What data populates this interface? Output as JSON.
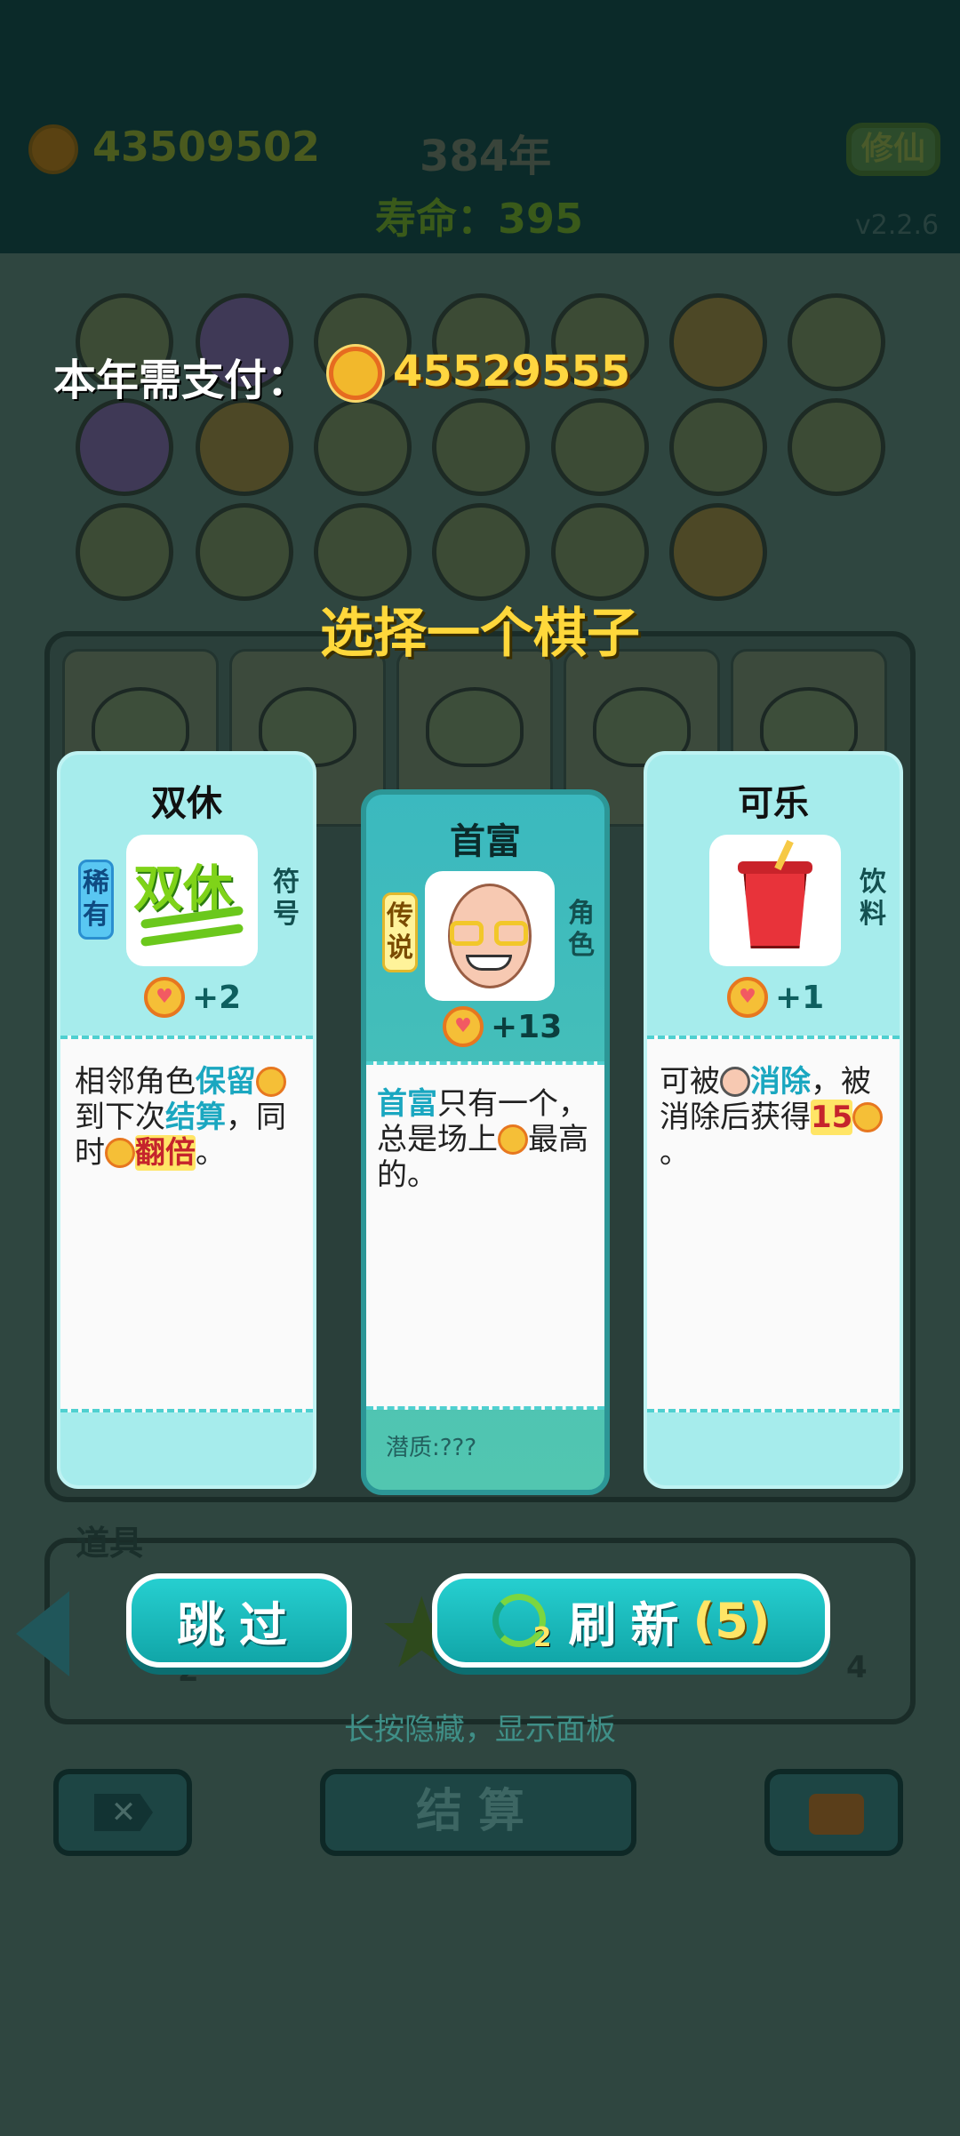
{
  "header": {
    "coins": "43509502",
    "year": "384年",
    "lifespan": "寿命：395",
    "top_button": "修仙",
    "version": "v2.2.6"
  },
  "payment": {
    "label": "本年需支付：",
    "value": "45529555"
  },
  "select_title": "选择一个棋子",
  "cards": [
    {
      "title": "双休",
      "rarity": "稀有",
      "category": "符号",
      "image_text": "双休",
      "gain": "+2",
      "desc": [
        "相邻角色",
        "保留",
        "到下次",
        "结算",
        "，同时",
        "翻倍",
        "。"
      ]
    },
    {
      "title": "首富",
      "rarity": "传说",
      "category": "角色",
      "gain": "+13",
      "desc": [
        "首富",
        "只有一个，总是场上",
        "最高的。"
      ],
      "potential": "潜质:???"
    },
    {
      "title": "可乐",
      "category": "饮料",
      "gain": "+1",
      "desc": [
        "可被",
        "消除",
        "，被消除后获得",
        "15",
        "。"
      ]
    }
  ],
  "tools": {
    "label": "道具",
    "count_left": "2",
    "count_right": "4"
  },
  "buttons": {
    "skip": "跳过",
    "refresh": "刷新",
    "refresh_count": "(5)",
    "refresh_icon_badge": "2"
  },
  "hint": "长按隐藏，显示面板",
  "bottom": {
    "settle": "结算"
  },
  "colors": {
    "accent": "#1aa7c0",
    "gold": "#ffd640",
    "card_bg": "#a6ecec"
  }
}
